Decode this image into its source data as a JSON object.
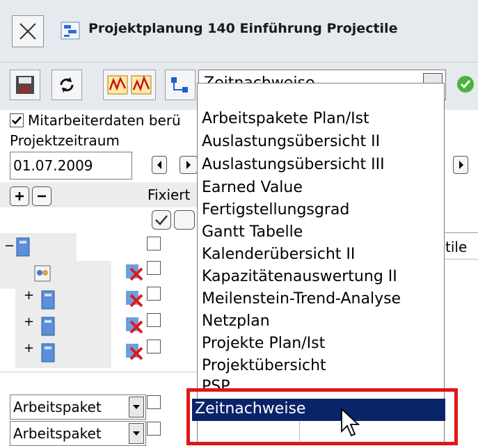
{
  "window": {
    "title": "Projektplanung 140 Einführung Projectile"
  },
  "toolbar": {
    "view_select_value": "Zeitnachweise"
  },
  "options": {
    "employee_data_label": "Mitarbeiterdaten berü",
    "employee_data_checked": true
  },
  "period": {
    "label": "Projektzeitraum",
    "start_date": "01.07.2009"
  },
  "tree": {
    "fixed_label": "Fixiert",
    "right_cell_text": "tile",
    "bottom_rows": [
      {
        "select_value": "Arbeitspaket"
      },
      {
        "select_value": "Arbeitspaket"
      }
    ]
  },
  "dropdown": {
    "items": [
      "Arbeitspakete Plan/Ist",
      "Auslastungsübersicht II",
      "Auslastungsübersicht III",
      "Earned Value",
      "Fertigstellungsgrad",
      "Gantt Tabelle",
      "Kalenderübersicht II",
      "Kapazitätenauswertung II",
      "Meilenstein-Trend-Analyse",
      "Netzplan",
      "Projekte Plan/Ist",
      "Projektübersicht",
      "PSP",
      "Zeitnachweise"
    ],
    "selected": "Zeitnachweise"
  },
  "colors": {
    "selection": "#0a246a",
    "highlight": "#e0161b"
  }
}
